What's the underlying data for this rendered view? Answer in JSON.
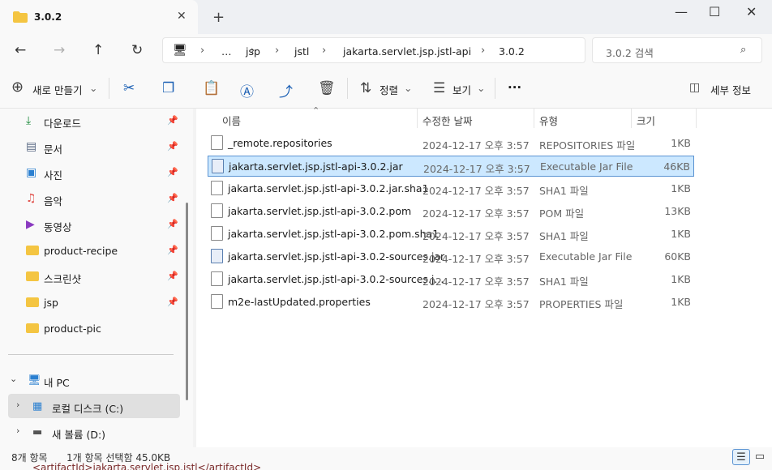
{
  "tab": {
    "title": "3.0.2",
    "close": "✕",
    "new": "+"
  },
  "window": {
    "minimize": "—",
    "maximize": "☐",
    "close": "✕"
  },
  "nav": {
    "back": "←",
    "forward": "→",
    "up": "↑",
    "refresh": "↻",
    "breadcrumbs": [
      "…",
      "jsp",
      "jstl",
      "jakarta.servlet.jsp.jstl-api",
      "3.0.2"
    ],
    "search_placeholder": "3.0.2 검색"
  },
  "toolbar": {
    "new": "새로 만들기",
    "sort": "정렬",
    "view": "보기",
    "more": "···",
    "details": "세부 정보"
  },
  "sidebar": {
    "quick": [
      {
        "label": "다운로드",
        "icon": "download-icon",
        "color": "#1a8a3a"
      },
      {
        "label": "문서",
        "icon": "document-icon",
        "color": "#5a6a85"
      },
      {
        "label": "사진",
        "icon": "pictures-icon",
        "color": "#2a7fd0"
      },
      {
        "label": "음악",
        "icon": "music-icon",
        "color": "#e0504a"
      },
      {
        "label": "동영상",
        "icon": "video-icon",
        "color": "#8a3ac0"
      },
      {
        "label": "product-recipe",
        "icon": "folder-icon",
        "color": "#f4c542"
      },
      {
        "label": "스크린샷",
        "icon": "folder-icon",
        "color": "#f4c542"
      },
      {
        "label": "jsp",
        "icon": "folder-icon",
        "color": "#f4c542"
      },
      {
        "label": "product-pic",
        "icon": "folder-icon",
        "color": "#f4c542"
      }
    ],
    "pc": {
      "label": "내 PC"
    },
    "drives": [
      {
        "label": "로컬 디스크 (C:)"
      },
      {
        "label": "새 볼륨 (D:)"
      }
    ]
  },
  "columns": {
    "name": "이름",
    "date": "수정한 날짜",
    "type": "유형",
    "size": "크기"
  },
  "files": [
    {
      "name": "_remote.repositories",
      "date": "2024-12-17 오후 3:57",
      "type": "REPOSITORIES 파일",
      "size": "1KB",
      "kind": "file"
    },
    {
      "name": "jakarta.servlet.jsp.jstl-api-3.0.2.jar",
      "date": "2024-12-17 오후 3:57",
      "type": "Executable Jar File",
      "size": "46KB",
      "kind": "jar",
      "selected": true
    },
    {
      "name": "jakarta.servlet.jsp.jstl-api-3.0.2.jar.sha1",
      "date": "2024-12-17 오후 3:57",
      "type": "SHA1 파일",
      "size": "1KB",
      "kind": "file"
    },
    {
      "name": "jakarta.servlet.jsp.jstl-api-3.0.2.pom",
      "date": "2024-12-17 오후 3:57",
      "type": "POM 파일",
      "size": "13KB",
      "kind": "file"
    },
    {
      "name": "jakarta.servlet.jsp.jstl-api-3.0.2.pom.sha1",
      "date": "2024-12-17 오후 3:57",
      "type": "SHA1 파일",
      "size": "1KB",
      "kind": "file"
    },
    {
      "name": "jakarta.servlet.jsp.jstl-api-3.0.2-sources.jar",
      "date": "2024-12-17 오후 3:57",
      "type": "Executable Jar File",
      "size": "60KB",
      "kind": "jar"
    },
    {
      "name": "jakarta.servlet.jsp.jstl-api-3.0.2-sources.j...",
      "date": "2024-12-17 오후 3:57",
      "type": "SHA1 파일",
      "size": "1KB",
      "kind": "file"
    },
    {
      "name": "m2e-lastUpdated.properties",
      "date": "2024-12-17 오후 3:57",
      "type": "PROPERTIES 파일",
      "size": "1KB",
      "kind": "file"
    }
  ],
  "status": {
    "count": "8개 항목",
    "selection": "1개 항목 선택함 45.0KB"
  },
  "peek_text": "<artifactId>jakarta.servlet.jsp.jstl</artifactId>"
}
